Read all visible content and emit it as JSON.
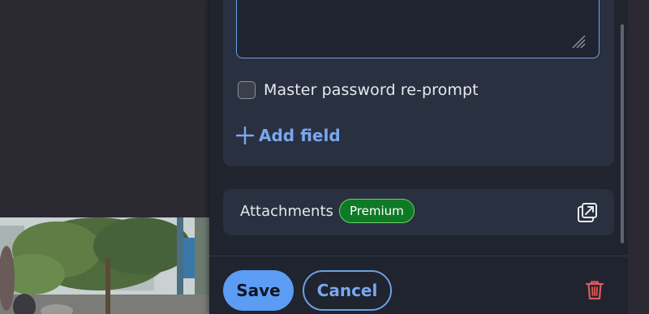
{
  "item_form": {
    "notes_value": "",
    "reprompt": {
      "label": "Master password re-prompt",
      "checked": false
    },
    "add_field": {
      "label": "Add field",
      "icon": "plus-icon"
    }
  },
  "attachments": {
    "label": "Attachments",
    "badge": "Premium",
    "open_icon": "open-in-new-window-icon"
  },
  "footer": {
    "save_label": "Save",
    "cancel_label": "Cancel",
    "delete_icon": "trash-icon"
  },
  "colors": {
    "accent": "#5c9cf5",
    "premium": "#0f7a25",
    "danger": "#e05a5a",
    "panel": "#1f242e",
    "card": "#293040"
  }
}
